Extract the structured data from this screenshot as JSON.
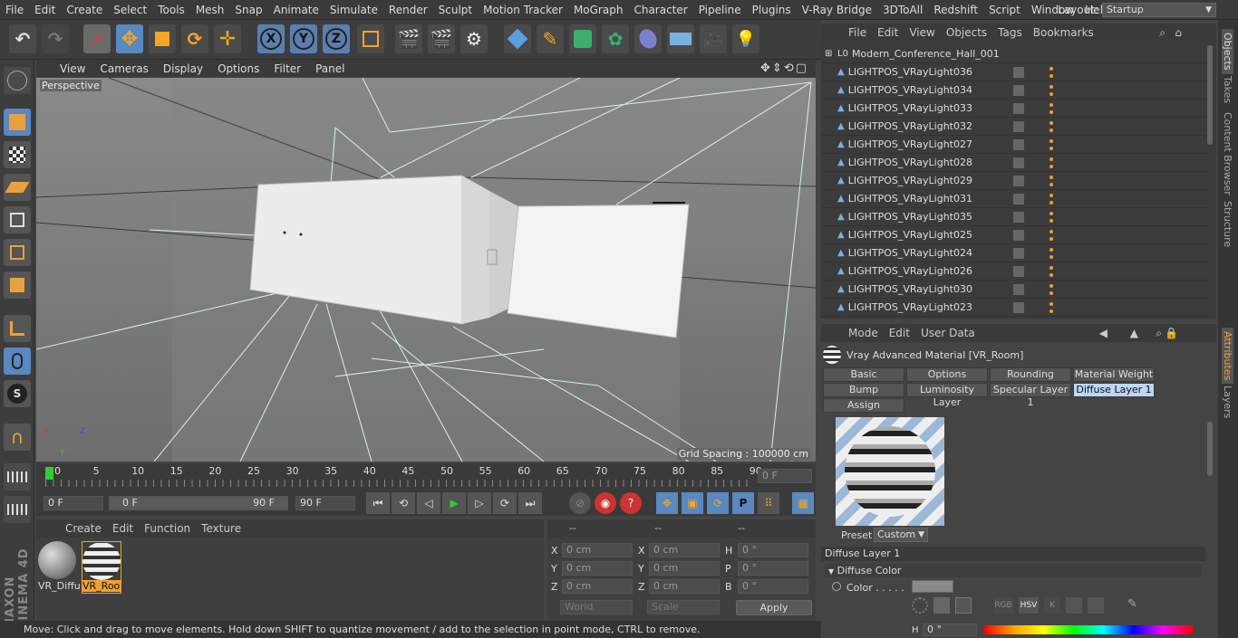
{
  "menubar": {
    "items": [
      "File",
      "Edit",
      "Create",
      "Select",
      "Tools",
      "Mesh",
      "Snap",
      "Animate",
      "Simulate",
      "Render",
      "Sculpt",
      "Motion Tracker",
      "MoGraph",
      "Character",
      "Pipeline",
      "Plugins",
      "V-Ray Bridge",
      "3DToAll",
      "Redshift",
      "Script",
      "Window",
      "Help"
    ],
    "layout_label": "Layout:",
    "layout_value": "Startup"
  },
  "toolbar": {
    "axis_x": "X",
    "axis_y": "Y",
    "axis_z": "Z"
  },
  "viewport": {
    "menu": [
      "View",
      "Cameras",
      "Display",
      "Options",
      "Filter",
      "Panel"
    ],
    "label": "Perspective",
    "grid_spacing": "Grid Spacing : 100000 cm",
    "axis_x": "X",
    "axis_y": "Y",
    "axis_z": "Z"
  },
  "timeline": {
    "ticks": [
      "0",
      "5",
      "10",
      "15",
      "20",
      "25",
      "30",
      "35",
      "40",
      "45",
      "50",
      "55",
      "60",
      "65",
      "70",
      "75",
      "80",
      "85",
      "90"
    ],
    "current_frame": "0 F"
  },
  "transport": {
    "start": "0 F",
    "range_start": "0 F",
    "range_end": "90 F",
    "end": "90 F"
  },
  "material_manager": {
    "menu": [
      "Create",
      "Edit",
      "Function",
      "Texture"
    ],
    "materials": [
      "VR_Diffu",
      "VR_Roo"
    ]
  },
  "coords": {
    "headers": [
      "--",
      "--",
      "--"
    ],
    "rows": [
      {
        "a": "X",
        "av": "0 cm",
        "b": "X",
        "bv": "0 cm",
        "c": "H",
        "cv": "0 °"
      },
      {
        "a": "Y",
        "av": "0 cm",
        "b": "Y",
        "bv": "0 cm",
        "c": "P",
        "cv": "0 °"
      },
      {
        "a": "Z",
        "av": "0 cm",
        "b": "Z",
        "bv": "0 cm",
        "c": "B",
        "cv": "0 °"
      }
    ],
    "world": "World",
    "scale": "Scale",
    "apply": "Apply"
  },
  "status": "Move: Click and drag to move elements. Hold down SHIFT to quantize movement / add to the selection in point mode, CTRL to remove.",
  "object_manager": {
    "menu": [
      "File",
      "Edit",
      "View",
      "Objects",
      "Tags",
      "Bookmarks"
    ],
    "root": "Modern_Conference_Hall_001",
    "items": [
      "LIGHTPOS_VRayLight036",
      "LIGHTPOS_VRayLight034",
      "LIGHTPOS_VRayLight033",
      "LIGHTPOS_VRayLight032",
      "LIGHTPOS_VRayLight027",
      "LIGHTPOS_VRayLight028",
      "LIGHTPOS_VRayLight029",
      "LIGHTPOS_VRayLight031",
      "LIGHTPOS_VRayLight035",
      "LIGHTPOS_VRayLight025",
      "LIGHTPOS_VRayLight024",
      "LIGHTPOS_VRayLight026",
      "LIGHTPOS_VRayLight030",
      "LIGHTPOS_VRayLight023"
    ]
  },
  "attributes": {
    "menu": [
      "Mode",
      "Edit",
      "User Data"
    ],
    "title": "Vray Advanced Material [VR_Room]",
    "tabs_row1": [
      "Basic",
      "Options",
      "Rounding",
      "Material Weight"
    ],
    "tabs_row2": [
      "Bump",
      "Luminosity Layer",
      "Specular Layer 1",
      "Diffuse Layer 1"
    ],
    "tabs_row3": [
      "Assign"
    ],
    "preset_label": "Preset",
    "preset_value": "Custom",
    "section": "Diffuse Layer 1",
    "group": "Diffuse Color",
    "color_label": "Color . . . . .",
    "mode_buttons": [
      "RGB",
      "HSV",
      "K"
    ],
    "h_label": "H",
    "h_value": "0 °"
  },
  "side_tabs": [
    "Objects",
    "Takes",
    "Content Browser",
    "Structure",
    "Attributes",
    "Layers"
  ],
  "branding": "MAXON CINEMA 4D",
  "colors": {
    "accent": "#4a88c7",
    "highlight": "#f0a030",
    "selected_tab": "#bcd6f5"
  }
}
